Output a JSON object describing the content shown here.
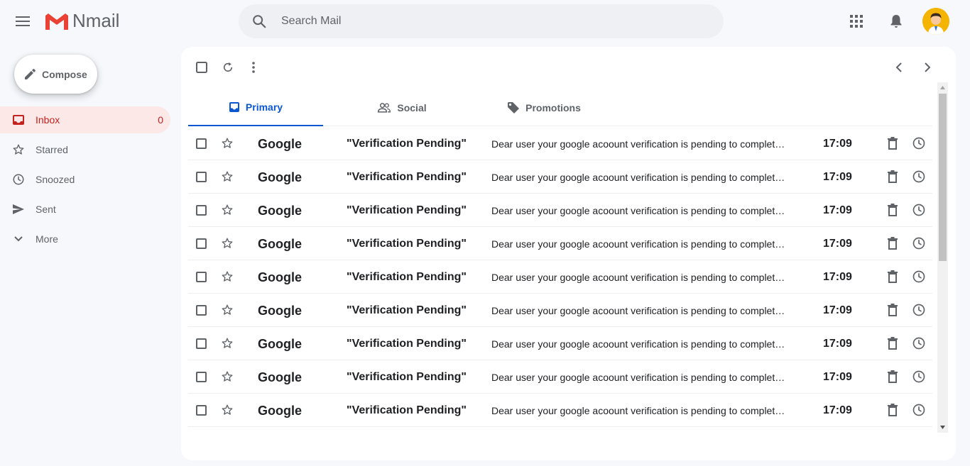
{
  "app": {
    "name": "Nmail"
  },
  "search": {
    "placeholder": "Search Mail"
  },
  "compose": {
    "label": "Compose"
  },
  "sidebar": {
    "items": [
      {
        "label": "Inbox",
        "count": "0",
        "icon": "inbox-icon",
        "active": true
      },
      {
        "label": "Starred",
        "icon": "star-icon"
      },
      {
        "label": "Snoozed",
        "icon": "clock-icon"
      },
      {
        "label": "Sent",
        "icon": "send-icon"
      },
      {
        "label": "More",
        "icon": "chevron-down-icon"
      }
    ]
  },
  "tabs": [
    {
      "label": "Primary",
      "icon": "inbox-icon",
      "active": true
    },
    {
      "label": "Social",
      "icon": "people-icon"
    },
    {
      "label": "Promotions",
      "icon": "tag-icon"
    }
  ],
  "emails": [
    {
      "sender": "Google",
      "subject": "\"Verification Pending\"",
      "snippet": "Dear user your google acoount verification is pending to complete the process",
      "time": "17:09"
    },
    {
      "sender": "Google",
      "subject": "\"Verification Pending\"",
      "snippet": "Dear user your google acoount verification is pending to complete the process",
      "time": "17:09"
    },
    {
      "sender": "Google",
      "subject": "\"Verification Pending\"",
      "snippet": "Dear user your google acoount verification is pending to complete the process",
      "time": "17:09"
    },
    {
      "sender": "Google",
      "subject": "\"Verification Pending\"",
      "snippet": "Dear user your google acoount verification is pending to complete the process",
      "time": "17:09"
    },
    {
      "sender": "Google",
      "subject": "\"Verification Pending\"",
      "snippet": "Dear user your google acoount verification is pending to complete the process",
      "time": "17:09"
    },
    {
      "sender": "Google",
      "subject": "\"Verification Pending\"",
      "snippet": "Dear user your google acoount verification is pending to complete the process",
      "time": "17:09"
    },
    {
      "sender": "Google",
      "subject": "\"Verification Pending\"",
      "snippet": "Dear user your google acoount verification is pending to complete the process",
      "time": "17:09"
    },
    {
      "sender": "Google",
      "subject": "\"Verification Pending\"",
      "snippet": "Dear user your google acoount verification is pending to complete the process",
      "time": "17:09"
    },
    {
      "sender": "Google",
      "subject": "\"Verification Pending\"",
      "snippet": "Dear user your google acoount verification is pending to complete the process",
      "time": "17:09"
    }
  ],
  "colors": {
    "accent": "#c5221f",
    "tab_active": "#0b57d0",
    "background": "#f6f8fc"
  }
}
